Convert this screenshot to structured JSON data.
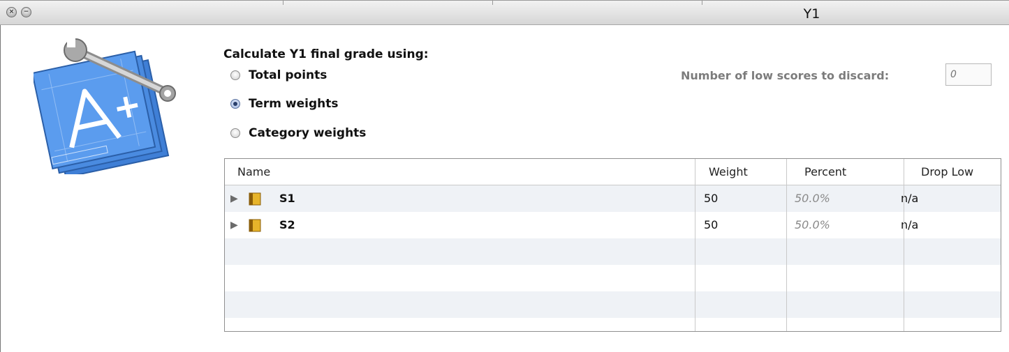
{
  "window": {
    "title": "Y1",
    "close_glyph": "×",
    "minimize_glyph": "−"
  },
  "options": {
    "heading": "Calculate Y1 final grade using:",
    "radios": [
      {
        "label": "Total points",
        "checked": false
      },
      {
        "label": "Term weights",
        "checked": true
      },
      {
        "label": "Category weights",
        "checked": false
      }
    ],
    "discard_label": "Number of low scores to discard:",
    "discard_placeholder": "0"
  },
  "table": {
    "headers": {
      "name": "Name",
      "weight": "Weight",
      "percent": "Percent",
      "drop_low": "Drop Low"
    },
    "rows": [
      {
        "name": "S1",
        "weight": "50",
        "percent": "50.0%",
        "drop_low": "n/a"
      },
      {
        "name": "S2",
        "weight": "50",
        "percent": "50.0%",
        "drop_low": "n/a"
      }
    ]
  },
  "icons": {
    "app": "grade-tools-app-icon",
    "row_disclosure": "disclosure-triangle-icon",
    "row_item": "book-icon"
  },
  "colors": {
    "row_alt": "#eff2f6",
    "radio_selected": "#2a3f6b",
    "book": "#d9a21b"
  }
}
